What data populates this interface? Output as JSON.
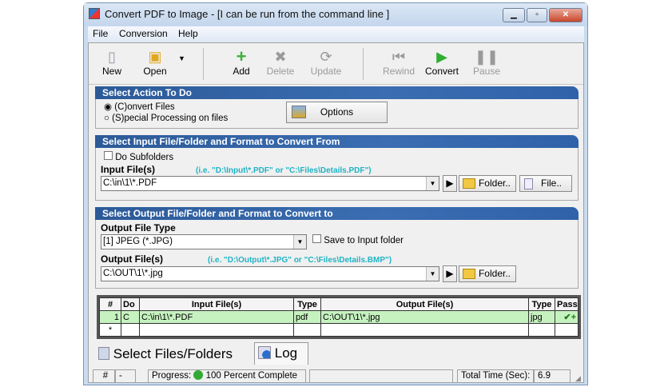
{
  "window": {
    "title": "Convert PDF to Image - [I can be run from the command line ]"
  },
  "menu": [
    "File",
    "Conversion",
    "Help"
  ],
  "toolbar": {
    "new": "New",
    "open": "Open",
    "add": "Add",
    "delete": "Delete",
    "update": "Update",
    "rewind": "Rewind",
    "convert": "Convert",
    "pause": "Pause"
  },
  "action": {
    "header": "Select Action To Do",
    "convert": "(C)onvert Files",
    "special": "(S)pecial Processing on files",
    "options": "Options"
  },
  "input": {
    "header": "Select Input File/Folder and Format to Convert From",
    "subfolders": "Do Subfolders",
    "label": "Input File(s)",
    "hint": "(i.e. \"D:\\Input\\*.PDF\"  or \"C:\\Files\\Details.PDF\")",
    "value": "C:\\in\\1\\*.PDF",
    "folder": "Folder..",
    "file": "File.."
  },
  "output": {
    "header": "Select Output File/Folder and Format to Convert to",
    "type_label": "Output File Type",
    "type_value": "[1] JPEG (*.JPG)",
    "save_input": "Save to Input folder",
    "label": "Output File(s)",
    "hint": "(i.e. \"D:\\Output\\*.JPG\"  or \"C:\\Files\\Details.BMP\")",
    "value": "C:\\OUT\\1\\*.jpg",
    "folder": "Folder.."
  },
  "grid": {
    "headers": [
      "#",
      "Do",
      "Input File(s)",
      "Type",
      "Output File(s)",
      "Type",
      "Pass"
    ],
    "rows": [
      [
        "1",
        "C",
        "C:\\in\\1\\*.PDF",
        "pdf",
        "C:\\OUT\\1\\*.jpg",
        "jpg",
        "✔+"
      ],
      [
        "*",
        "",
        "",
        "",
        "",
        "",
        ""
      ]
    ]
  },
  "tabs": {
    "files": "Select Files/Folders",
    "log": "Log"
  },
  "status": {
    "hash": "#",
    "dash": "-",
    "progress_label": "Progress:",
    "progress": "100 Percent Complete",
    "time_label": "Total Time (Sec):",
    "time": "6.9"
  },
  "colors": {
    "header": "#2c5a98",
    "selected_row": "#c6f2c0",
    "hint": "#1fb3c4"
  }
}
